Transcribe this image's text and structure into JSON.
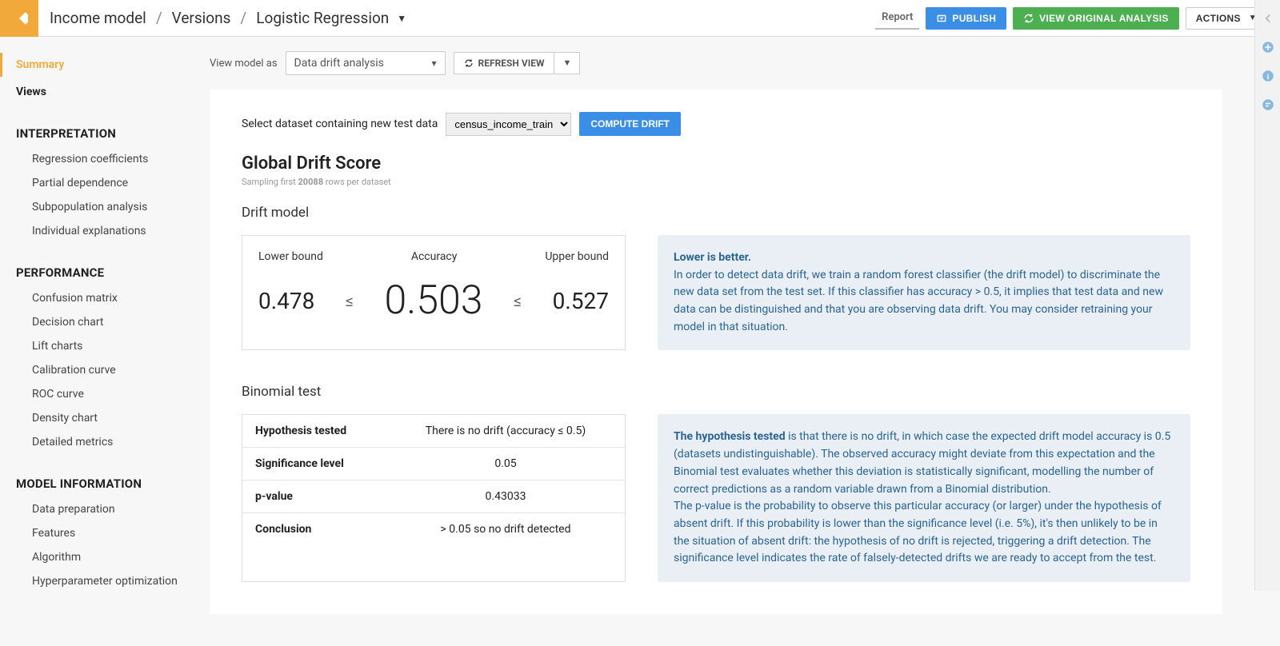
{
  "breadcrumbs": {
    "item0": "Income model",
    "item1": "Versions",
    "item2": "Logistic Regression"
  },
  "topbar": {
    "report": "Report",
    "publish": "PUBLISH",
    "view_original": "VIEW ORIGINAL ANALYSIS",
    "actions": "ACTIONS"
  },
  "sidebar": {
    "summary": "Summary",
    "views": "Views",
    "heading_interp": "INTERPRETATION",
    "interp": [
      "Regression coefficients",
      "Partial dependence",
      "Subpopulation analysis",
      "Individual explanations"
    ],
    "heading_perf": "PERFORMANCE",
    "perf": [
      "Confusion matrix",
      "Decision chart",
      "Lift charts",
      "Calibration curve",
      "ROC curve",
      "Density chart",
      "Detailed metrics"
    ],
    "heading_modelinfo": "MODEL INFORMATION",
    "modelinfo": [
      "Data preparation",
      "Features",
      "Algorithm",
      "Hyperparameter optimization"
    ]
  },
  "viewas": {
    "label": "View model as",
    "value": "Data drift analysis",
    "refresh": "REFRESH VIEW"
  },
  "dataset_row": {
    "label": "Select dataset containing new test data",
    "value": "census_income_train",
    "compute": "COMPUTE DRIFT"
  },
  "global_drift": {
    "title": "Global Drift Score",
    "sampling_prefix": "Sampling first ",
    "sampling_num": "20088",
    "sampling_suffix": " rows per dataset"
  },
  "drift_model": {
    "heading": "Drift model",
    "lower_label": "Lower bound",
    "accuracy_label": "Accuracy",
    "upper_label": "Upper bound",
    "lower": "0.478",
    "accuracy": "0.503",
    "upper": "0.527",
    "info_lead": "Lower is better.",
    "info_body": "In order to detect data drift, we train a random forest classifier (the drift model) to discriminate the new data set from the test set. If this classifier has accuracy > 0.5, it implies that test data and new data can be distinguished and that you are observing data drift. You may consider retraining your model in that situation."
  },
  "binomial": {
    "heading": "Binomial test",
    "rows": [
      {
        "key": "Hypothesis tested",
        "val": "There is no drift (accuracy ≤ 0.5)"
      },
      {
        "key": "Significance level",
        "val": "0.05"
      },
      {
        "key": "p-value",
        "val": "0.43033"
      },
      {
        "key": "Conclusion",
        "val": "> 0.05 so no drift detected"
      }
    ],
    "info_lead": "The hypothesis tested",
    "info_p1": " is that there is no drift, in which case the expected drift model accuracy is 0.5 (datasets undistinguishable). The observed accuracy might deviate from this expectation and the Binomial test evaluates whether this deviation is statistically significant, modelling the number of correct predictions as a random variable drawn from a Binomial distribution.",
    "info_p2": "The p-value is the probability to observe this particular accuracy (or larger) under the hypothesis of absent drift. If this probability is lower than the significance level (i.e. 5%), it's then unlikely to be in the situation of absent drift: the hypothesis of no drift is rejected, triggering a drift detection. The significance level indicates the rate of falsely-detected drifts we are ready to accept from the test."
  }
}
